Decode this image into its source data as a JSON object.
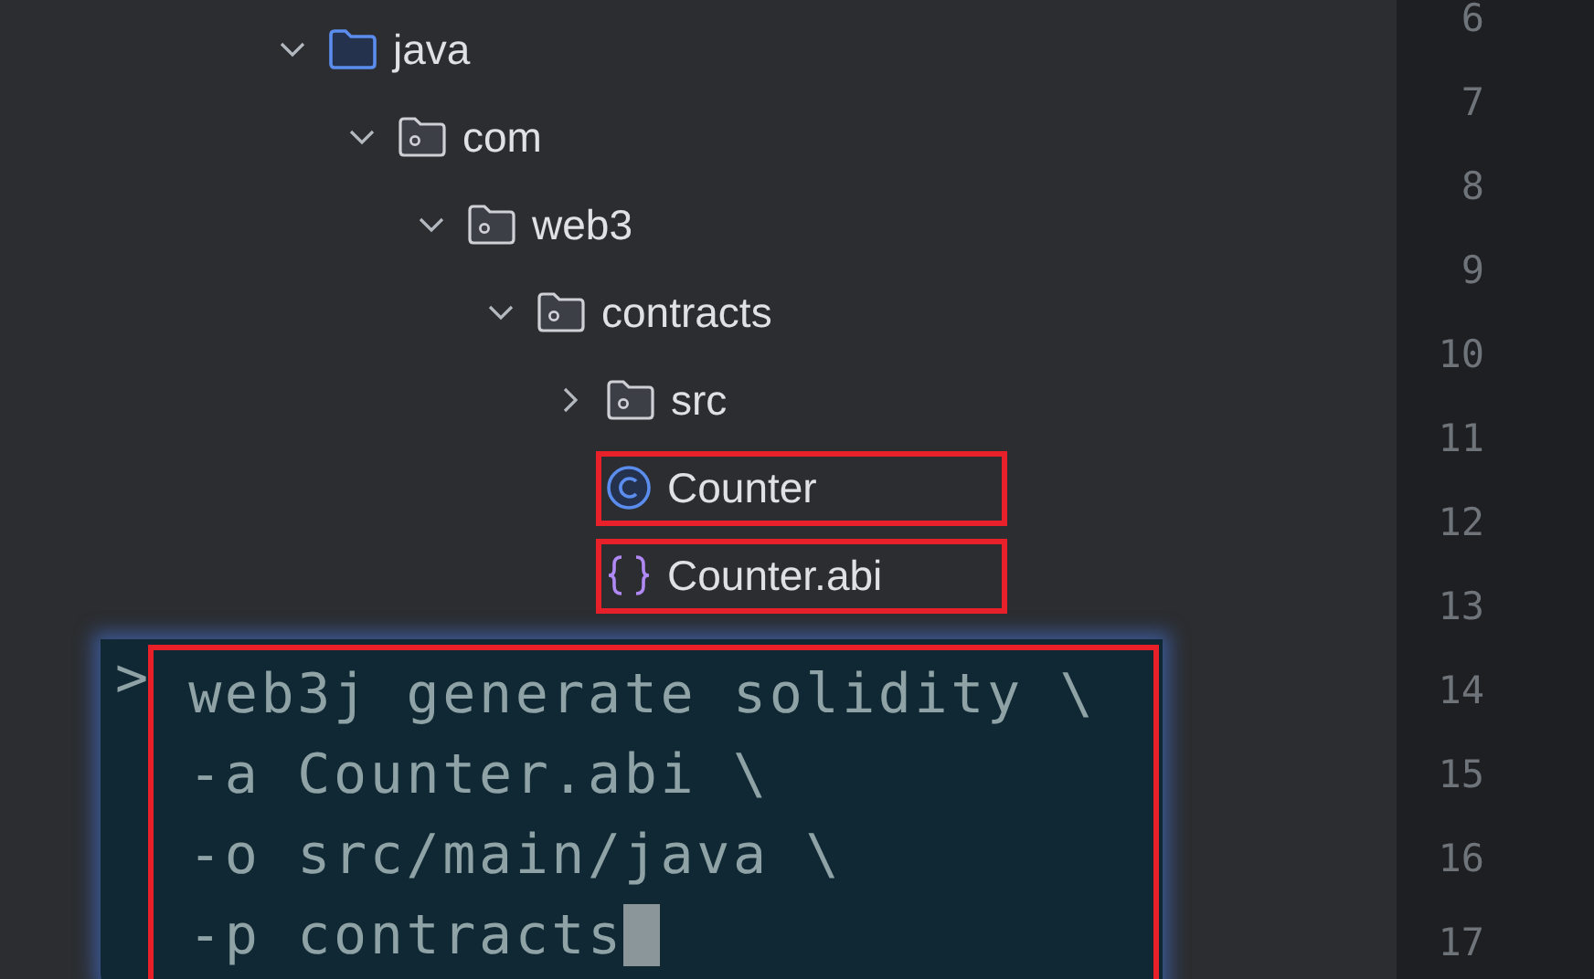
{
  "tree": [
    {
      "label": "java",
      "kind": "source-folder",
      "expanded": true,
      "children": [
        {
          "label": "com",
          "kind": "package",
          "expanded": true,
          "children": [
            {
              "label": "web3",
              "kind": "package",
              "expanded": true,
              "children": [
                {
                  "label": "contracts",
                  "kind": "package",
                  "expanded": true,
                  "children": [
                    {
                      "label": "src",
                      "kind": "package",
                      "expanded": false,
                      "highlighted": false
                    },
                    {
                      "label": "Counter",
                      "kind": "class",
                      "highlighted": true
                    },
                    {
                      "label": "Counter.abi",
                      "kind": "abi",
                      "highlighted": true
                    }
                  ]
                }
              ]
            }
          ]
        }
      ]
    }
  ],
  "terminal": {
    "prompt": ">",
    "highlighted": true,
    "lines": [
      "web3j generate solidity \\",
      "-a Counter.abi \\",
      "-o src/main/java \\",
      "-p contracts"
    ]
  },
  "line_numbers": [
    "6",
    "7",
    "8",
    "9",
    "10",
    "11",
    "12",
    "13",
    "14",
    "15",
    "16",
    "17"
  ]
}
